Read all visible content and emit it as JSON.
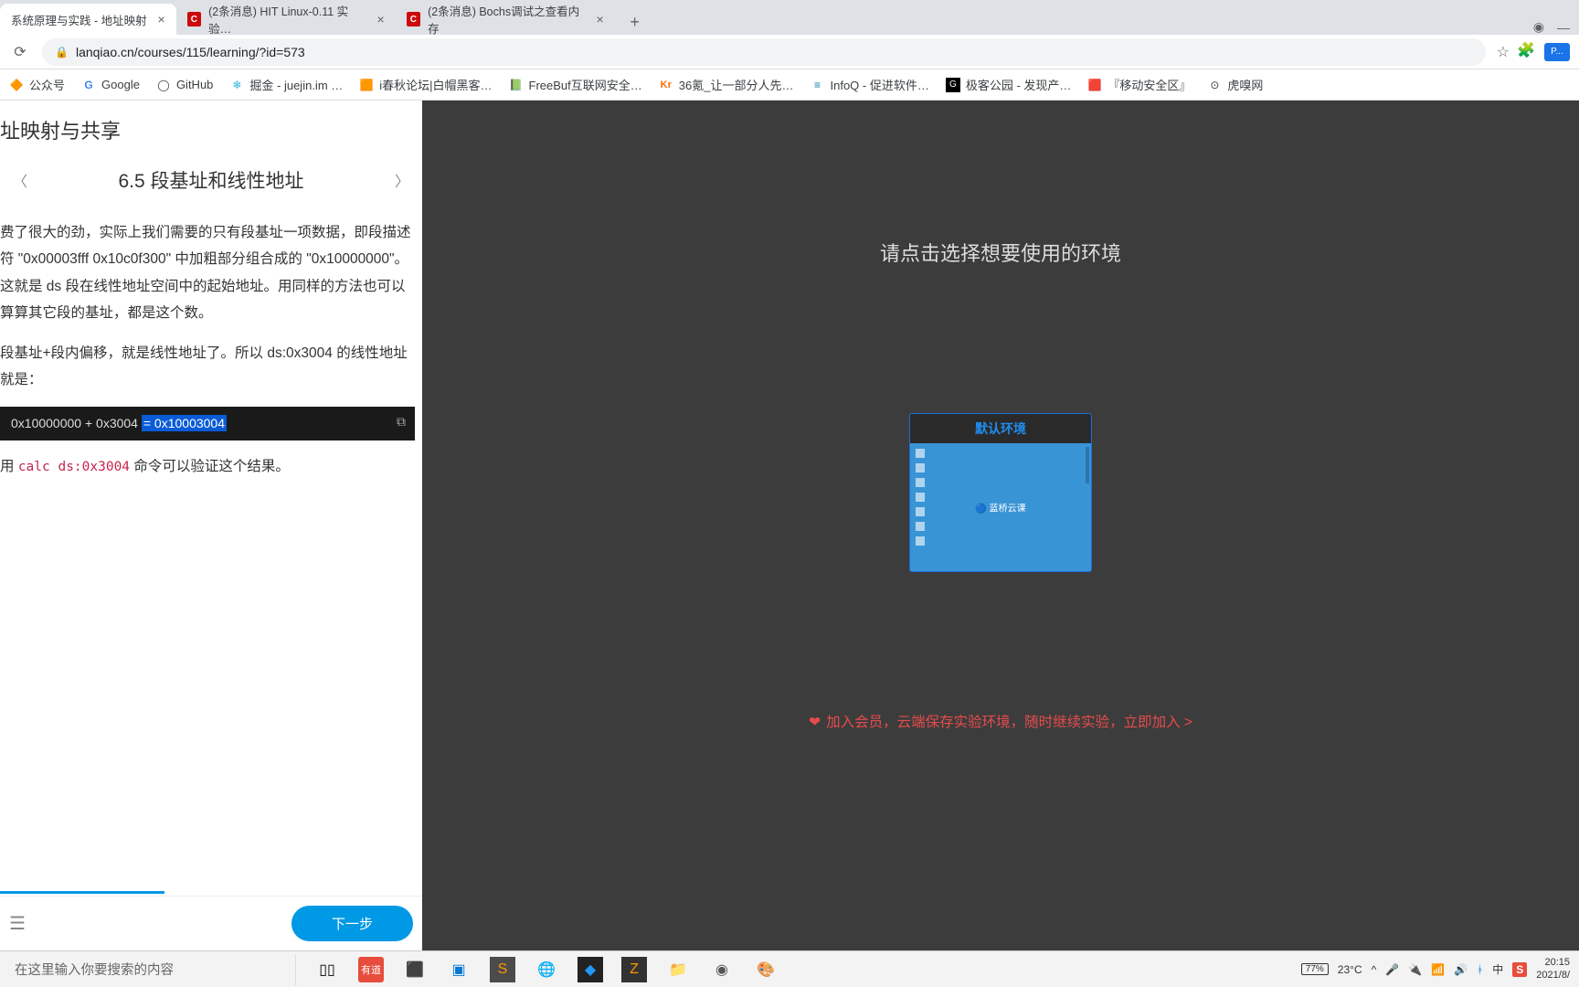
{
  "tabs": [
    {
      "title": "系统原理与实践 - 地址映射",
      "active": true
    },
    {
      "title": "(2条消息) HIT Linux-0.11 实验…",
      "active": false
    },
    {
      "title": "(2条消息) Bochs调试之查看内存",
      "active": false
    }
  ],
  "url": "lanqiao.cn/courses/115/learning/?id=573",
  "profile_label": "P...",
  "bookmarks": [
    {
      "label": "公众号",
      "icon": "🔶"
    },
    {
      "label": "Google",
      "icon": "G"
    },
    {
      "label": "GitHub",
      "icon": "◯"
    },
    {
      "label": "掘金 - juejin.im …",
      "icon": "❄"
    },
    {
      "label": "i春秋论坛|白帽黑客…",
      "icon": "🟧"
    },
    {
      "label": "FreeBuf互联网安全…",
      "icon": "📗"
    },
    {
      "label": "36氪_让一部分人先…",
      "icon": "Kr"
    },
    {
      "label": "InfoQ - 促进软件…",
      "icon": "≡"
    },
    {
      "label": "极客公园 - 发现产…",
      "icon": "G"
    },
    {
      "label": "『移动安全区』",
      "icon": "🟥"
    },
    {
      "label": "虎嗅网",
      "icon": "⊙"
    }
  ],
  "page_title": "址映射与共享",
  "section_no": "6.5",
  "section_title": "段基址和线性地址",
  "para1": "费了很大的劲，实际上我们需要的只有段基址一项数据，即段描述符 \"0x00003fff 0x10c0f300\" 中加粗部分组合成的 \"0x10000000\"。这就是 ds 段在线性地址空间中的起始地址。用同样的方法也可以算算其它段的基址，都是这个数。",
  "para2": "段基址+段内偏移，就是线性地址了。所以 ds:0x3004 的线性地址就是：",
  "code_pre": "0x10000000 + 0x3004 ",
  "code_sel": "= 0x10003004",
  "para3_prefix": "用 ",
  "para3_code": "calc ds:0x3004",
  "para3_suffix": " 命令可以验证这个结果。",
  "next_btn": "下一步",
  "env_prompt": "请点击选择想要使用的环境",
  "env_card_title": "默认环境",
  "env_brand": "🔵 蓝桥云课",
  "join_text": "加入会员，云端保存实验环境，随时继续实验，立即加入 >",
  "search_placeholder": "在这里输入你要搜索的内容",
  "temp": "23°C",
  "battery": "77%",
  "time": "20:15",
  "date": "2021/8/",
  "favicon_letter": "C"
}
